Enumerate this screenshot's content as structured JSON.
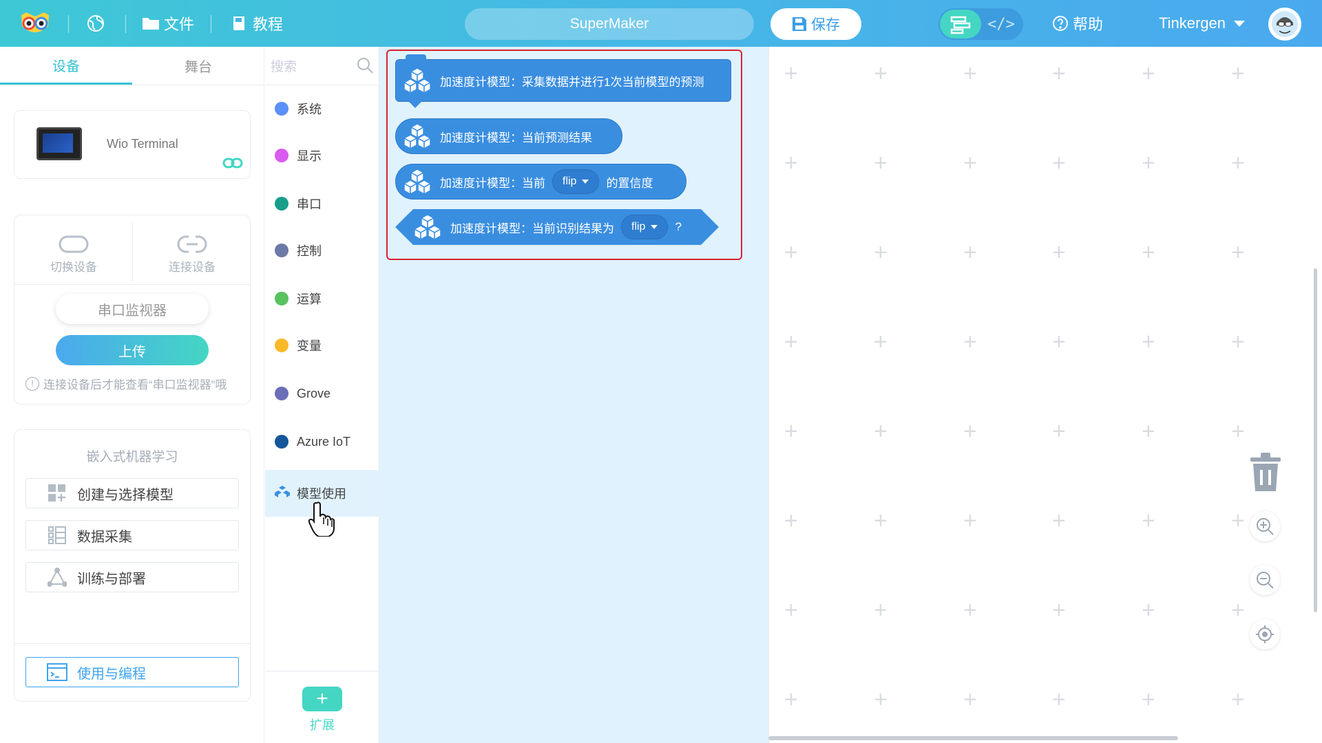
{
  "topbar": {
    "file_label": "文件",
    "tutorial_label": "教程",
    "project_name": "SuperMaker",
    "save_label": "保存",
    "code_toggle_label": "</>",
    "help_label": "帮助",
    "user_name": "Tinkergen"
  },
  "left_panel": {
    "tabs": [
      "设备",
      "舞台"
    ],
    "device_name": "Wio Terminal",
    "switch_device": "切换设备",
    "connect_device": "连接设备",
    "serial_monitor": "串口监视器",
    "upload": "上传",
    "hint": "连接设备后才能查看“串口监视器”哦",
    "ml_title": "嵌入式机器学习",
    "ml_items": [
      "创建与选择模型",
      "数据采集",
      "训练与部署",
      "使用与编程"
    ]
  },
  "categories": {
    "search_placeholder": "搜索",
    "items": [
      {
        "label": "系统",
        "color": "#5b8ff9"
      },
      {
        "label": "显示",
        "color": "#d95bf0"
      },
      {
        "label": "串口",
        "color": "#169e8b"
      },
      {
        "label": "控制",
        "color": "#6c7aa8"
      },
      {
        "label": "运算",
        "color": "#59c25f"
      },
      {
        "label": "变量",
        "color": "#fbb829"
      },
      {
        "label": "Grove",
        "color": "#6b6fb8"
      },
      {
        "label": "Azure IoT",
        "color": "#15559a"
      },
      {
        "label": "模型使用",
        "color": "#3a8ee0"
      }
    ],
    "extension_label": "扩展"
  },
  "blocks": {
    "b1": "加速度计模型：采集数据并进行1次当前模型的预测",
    "b2": "加速度计模型：当前预测结果",
    "b3_pre": "加速度计模型：当前",
    "b3_dd": "flip",
    "b3_post": "的置信度",
    "b4_pre": "加速度计模型：当前识别结果为",
    "b4_dd": "flip",
    "b4_post": "?"
  },
  "colors": {
    "accent": "#38c3d4",
    "block": "#3a8ee0",
    "highlight": "#d6232e"
  }
}
